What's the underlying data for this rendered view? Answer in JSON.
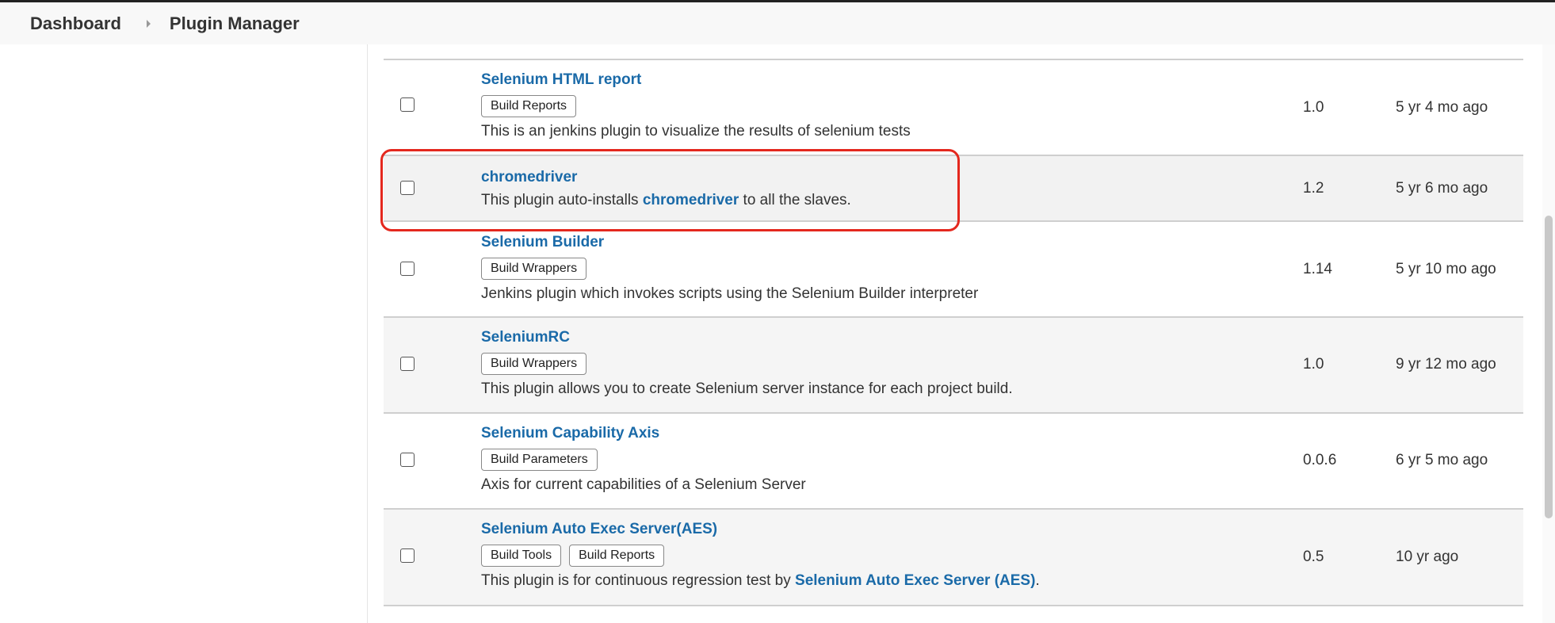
{
  "breadcrumb": {
    "items": [
      "Dashboard",
      "Plugin Manager"
    ]
  },
  "plugins": [
    {
      "name": "Selenium HTML report",
      "tags": [
        "Build Reports"
      ],
      "description": [
        {
          "text": "This is an jenkins plugin to visualize the results of selenium tests"
        }
      ],
      "version": "1.0",
      "released": "5 yr 4 mo ago"
    },
    {
      "name": "chromedriver",
      "tags": [],
      "description": [
        {
          "text": "This plugin auto-installs "
        },
        {
          "text": "chromedriver",
          "link": true
        },
        {
          "text": " to all the slaves."
        }
      ],
      "version": "1.2",
      "released": "5 yr 6 mo ago"
    },
    {
      "name": "Selenium Builder",
      "tags": [
        "Build Wrappers"
      ],
      "description": [
        {
          "text": "Jenkins plugin which invokes scripts using the Selenium Builder interpreter"
        }
      ],
      "version": "1.14",
      "released": "5 yr 10 mo ago"
    },
    {
      "name": "SeleniumRC",
      "tags": [
        "Build Wrappers"
      ],
      "description": [
        {
          "text": "This plugin allows you to create Selenium server instance for each project build."
        }
      ],
      "version": "1.0",
      "released": "9 yr 12 mo ago"
    },
    {
      "name": "Selenium Capability Axis",
      "tags": [
        "Build Parameters"
      ],
      "description": [
        {
          "text": "Axis for current capabilities of a Selenium Server"
        }
      ],
      "version": "0.0.6",
      "released": "6 yr 5 mo ago"
    },
    {
      "name": "Selenium Auto Exec Server(AES)",
      "tags": [
        "Build Tools",
        "Build Reports"
      ],
      "description": [
        {
          "text": "This plugin is for continuous regression test by "
        },
        {
          "text": "Selenium Auto Exec Server (AES)",
          "link": true
        },
        {
          "text": "."
        }
      ],
      "version": "0.5",
      "released": "10 yr ago"
    }
  ],
  "colors": {
    "link": "#1a6aa8",
    "highlight": "#e4281e"
  }
}
